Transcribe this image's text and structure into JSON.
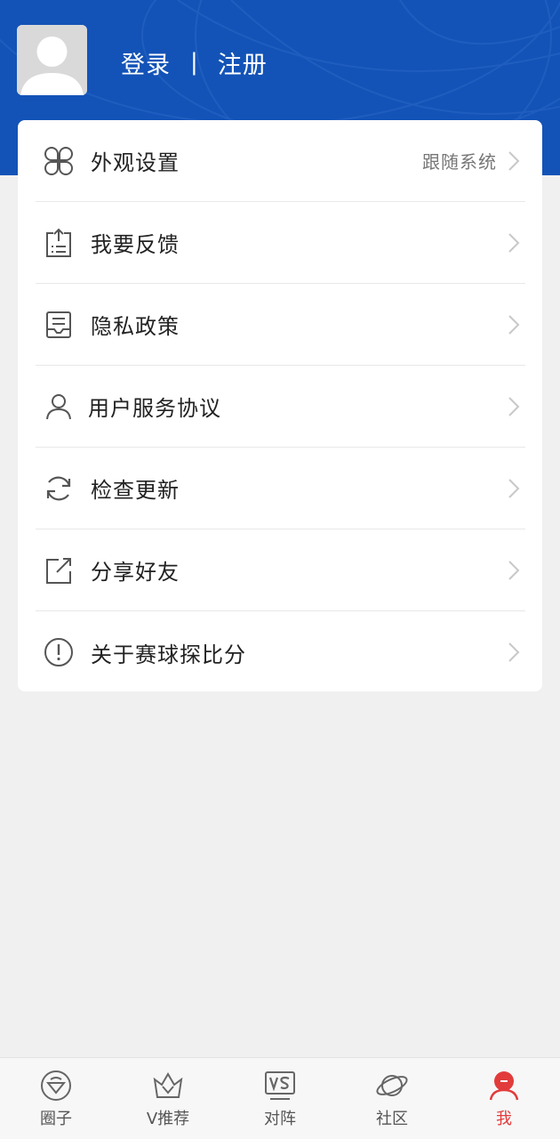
{
  "header": {
    "login_label": "登录",
    "separator": "|",
    "register_label": "注册"
  },
  "menu": {
    "items": [
      {
        "label": "外观设置",
        "value": "跟随系统",
        "icon": "appearance-icon"
      },
      {
        "label": "我要反馈",
        "icon": "feedback-icon"
      },
      {
        "label": "隐私政策",
        "icon": "privacy-icon"
      },
      {
        "label": "用户服务协议",
        "icon": "user-icon"
      },
      {
        "label": "检查更新",
        "icon": "refresh-icon"
      },
      {
        "label": "分享好友",
        "icon": "share-icon"
      },
      {
        "label": "关于赛球探比分",
        "icon": "info-icon"
      }
    ]
  },
  "tabbar": {
    "tabs": [
      {
        "label": "圈子",
        "icon": "circle-icon"
      },
      {
        "label": "V推荐",
        "icon": "crown-icon"
      },
      {
        "label": "对阵",
        "icon": "vs-icon"
      },
      {
        "label": "社区",
        "icon": "planet-icon"
      },
      {
        "label": "我",
        "icon": "profile-icon",
        "active": true
      }
    ]
  },
  "colors": {
    "header_bg": "#1353b7",
    "active_tab": "#e23b3b",
    "page_bg": "#f0f0f0"
  }
}
